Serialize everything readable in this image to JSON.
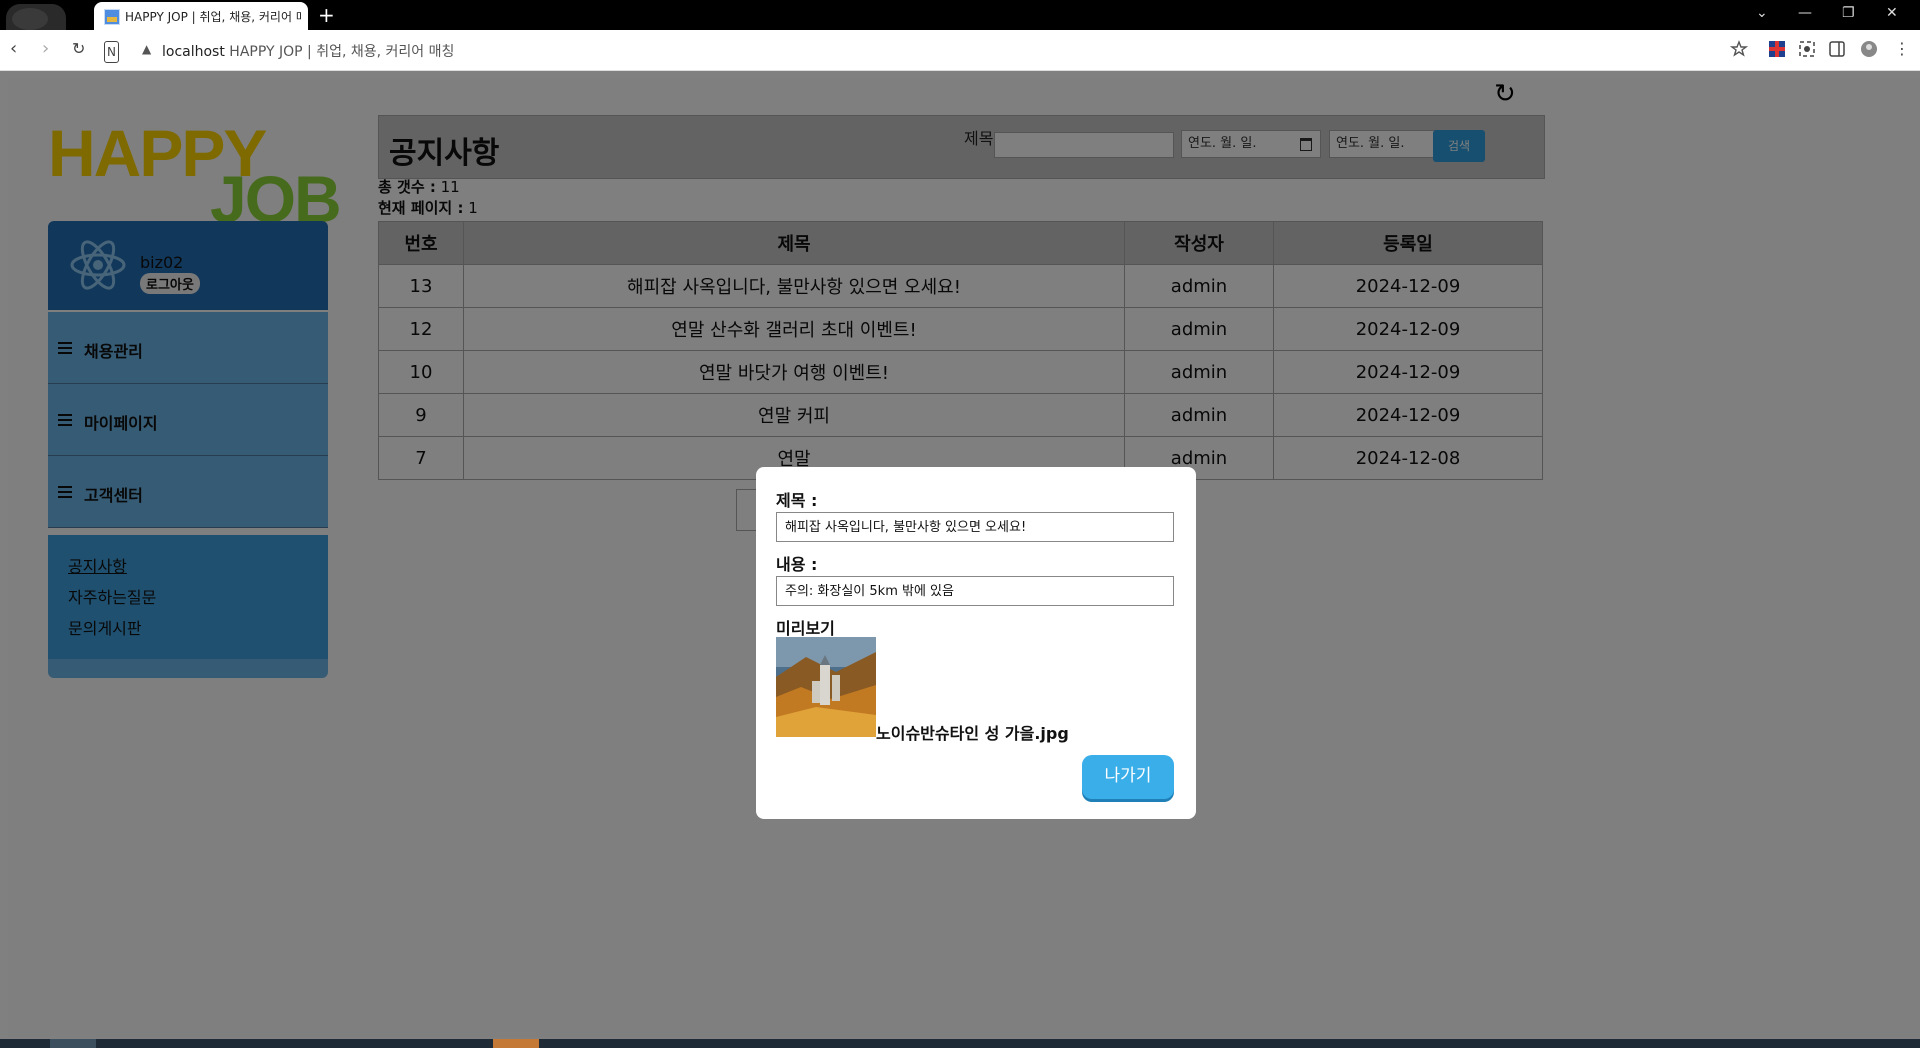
{
  "browser": {
    "tab_title": "HAPPY JOP | 취업, 채용, 커리어 매칭",
    "new_tab": "+",
    "url_host": "localhost",
    "url_title": "HAPPY JOP | 취업, 채용, 커리어 매칭"
  },
  "sidebar": {
    "logo_happy": "HAPPY",
    "logo_job": "JOB",
    "user_id": "biz02",
    "logout_label": "로그아웃",
    "menu": [
      {
        "label": "채용관리"
      },
      {
        "label": "마이페이지"
      },
      {
        "label": "고객센터"
      }
    ],
    "submenu": [
      {
        "label": "공지사항"
      },
      {
        "label": "자주하는질문"
      },
      {
        "label": "문의게시판"
      }
    ]
  },
  "main": {
    "refresh_icon": "↻",
    "heading": "공지사항",
    "search_title_label": "제목",
    "date_placeholder_1": "연도. 월. 일.",
    "date_placeholder_2": "연도. 월. 일.",
    "search_button": "검색",
    "total_label": "총 갯수 :",
    "total_value": "11",
    "page_label": "현재 페이지 :",
    "page_value": "1",
    "table": {
      "headers": [
        "번호",
        "제목",
        "작성자",
        "등록일"
      ],
      "rows": [
        {
          "no": "13",
          "title": "해피잡 사옥입니다, 불만사항 있으면 오세요!",
          "author": "admin",
          "date": "2024-12-09"
        },
        {
          "no": "12",
          "title": "연말 산수화 갤러리 초대 이벤트!",
          "author": "admin",
          "date": "2024-12-09"
        },
        {
          "no": "10",
          "title": "연말 바닷가 여행 이벤트!",
          "author": "admin",
          "date": "2024-12-09"
        },
        {
          "no": "9",
          "title": "연말 커피",
          "author": "admin",
          "date": "2024-12-09"
        },
        {
          "no": "7",
          "title": "연말",
          "author": "admin",
          "date": "2024-12-08"
        }
      ]
    }
  },
  "modal": {
    "title_label": "제목 :",
    "title_value": "해피잡 사옥입니다, 불만사항 있으면 오세요!",
    "content_label": "내용 :",
    "content_value": "주의: 화장실이 5km 밖에 있음",
    "preview_label": "미리보기",
    "file_name": "노이슈반슈타인 성 가을.jpg",
    "exit_button": "나가기"
  },
  "colors": {
    "accent": "#3aaee8",
    "profile_bg": "#226fb6",
    "menu_bg": "#6cb7e8",
    "submenu_bg": "#3ea0e0",
    "logo_yellow": "#ffd500",
    "logo_green": "#8fd63b"
  }
}
